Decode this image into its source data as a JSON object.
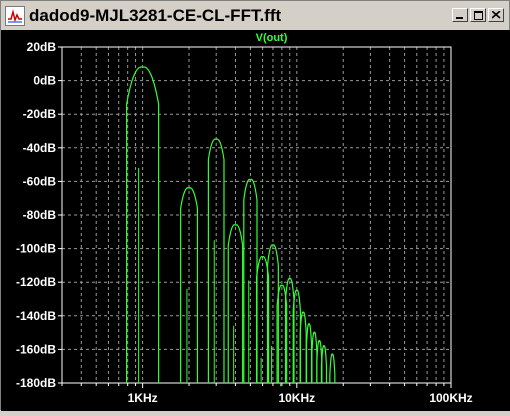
{
  "window": {
    "title": "dadod9-MJL3281-CE-CL-FFT.fft",
    "icon": "waveform-icon",
    "controls": [
      "minimize",
      "maximize",
      "close"
    ]
  },
  "plot": {
    "trace_name": "V(out)",
    "trace_color": "#33ff33",
    "background": "#000000",
    "axis_color": "#ffffff",
    "grid_color": "#9a9a9a"
  },
  "chart_data": {
    "type": "line",
    "title": "V(out)",
    "xscale": "log",
    "xlim": [
      300,
      100000
    ],
    "ylim": [
      -180,
      20
    ],
    "x_ticks": [
      {
        "value": 1000,
        "label": "1KHz"
      },
      {
        "value": 10000,
        "label": "10KHz"
      },
      {
        "value": 100000,
        "label": "100KHz"
      }
    ],
    "y_ticks": [
      {
        "value": 20,
        "label": "20dB"
      },
      {
        "value": 0,
        "label": "0dB"
      },
      {
        "value": -20,
        "label": "-20dB"
      },
      {
        "value": -40,
        "label": "-40dB"
      },
      {
        "value": -60,
        "label": "-60dB"
      },
      {
        "value": -80,
        "label": "-80dB"
      },
      {
        "value": -100,
        "label": "-100dB"
      },
      {
        "value": -120,
        "label": "-120dB"
      },
      {
        "value": -140,
        "label": "-140dB"
      },
      {
        "value": -160,
        "label": "-160dB"
      },
      {
        "value": -180,
        "label": "-180dB"
      }
    ],
    "grid": true,
    "series": [
      {
        "name": "V(out)",
        "harmonics": [
          {
            "f": 1000,
            "db": 8
          },
          {
            "f": 2000,
            "db": -64
          },
          {
            "f": 3000,
            "db": -35
          },
          {
            "f": 4000,
            "db": -86
          },
          {
            "f": 5000,
            "db": -59
          },
          {
            "f": 6000,
            "db": -105
          },
          {
            "f": 7000,
            "db": -98
          },
          {
            "f": 8000,
            "db": -122
          },
          {
            "f": 9000,
            "db": -118
          },
          {
            "f": 10000,
            "db": -125
          },
          {
            "f": 11000,
            "db": -138
          },
          {
            "f": 12000,
            "db": -145
          },
          {
            "f": 13000,
            "db": -150
          },
          {
            "f": 14000,
            "db": -155
          },
          {
            "f": 15000,
            "db": -158
          },
          {
            "f": 17000,
            "db": -163
          }
        ]
      }
    ]
  }
}
